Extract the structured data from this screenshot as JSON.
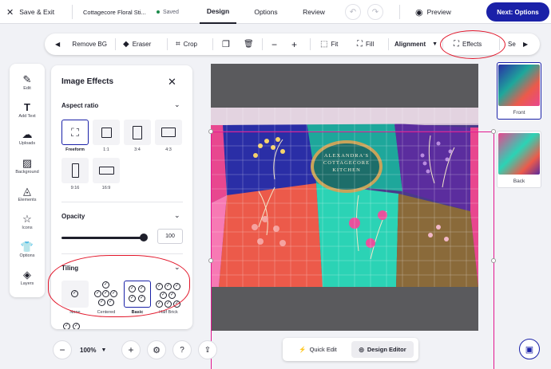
{
  "topbar": {
    "save_exit": "Save & Exit",
    "doc_name": "Cottagecore Floral Sti...",
    "saved": "Saved",
    "tabs": [
      "Design",
      "Options",
      "Review"
    ],
    "preview": "Preview",
    "next": "Next: Options"
  },
  "toolbar": {
    "remove_bg": "Remove BG",
    "eraser": "Eraser",
    "crop": "Crop",
    "fit": "Fit",
    "fill": "Fill",
    "alignment": "Alignment",
    "effects": "Effects",
    "more": "Se"
  },
  "left_rail": [
    {
      "label": "Edit",
      "icon": "magic-wand-icon"
    },
    {
      "label": "Add Text",
      "icon": "text-icon"
    },
    {
      "label": "Uploads",
      "icon": "upload-cloud-icon"
    },
    {
      "label": "Background",
      "icon": "background-icon"
    },
    {
      "label": "Elements",
      "icon": "elements-icon"
    },
    {
      "label": "Icons",
      "icon": "star-icon"
    },
    {
      "label": "Options",
      "icon": "tshirt-icon"
    },
    {
      "label": "Layers",
      "icon": "layers-icon"
    }
  ],
  "panel": {
    "title": "Image Effects",
    "aspect_ratio_label": "Aspect ratio",
    "ratios": [
      "Freeform",
      "1:1",
      "3:4",
      "4:3",
      "9:16",
      "16:9"
    ],
    "selected_ratio": "Freeform",
    "opacity_label": "Opacity",
    "opacity_value": "100",
    "opacity_fraction": 1.0,
    "tiling_label": "Tiling",
    "tilings": [
      "None",
      "Centered",
      "Basic",
      "Half Brick"
    ],
    "selected_tiling": "Basic"
  },
  "artwork": {
    "badge_line1": "ALEXANDRA'S",
    "badge_line2": "COTTAGECORE",
    "badge_line3": "KITCHEN"
  },
  "pages": [
    "Front",
    "Back"
  ],
  "bottom": {
    "zoom": "100%",
    "quick_edit": "Quick Edit",
    "design_editor": "Design Editor"
  },
  "colors": {
    "accent": "#1a21a8",
    "annotation_red": "#e2162a",
    "selection_pink": "#e2168f"
  }
}
